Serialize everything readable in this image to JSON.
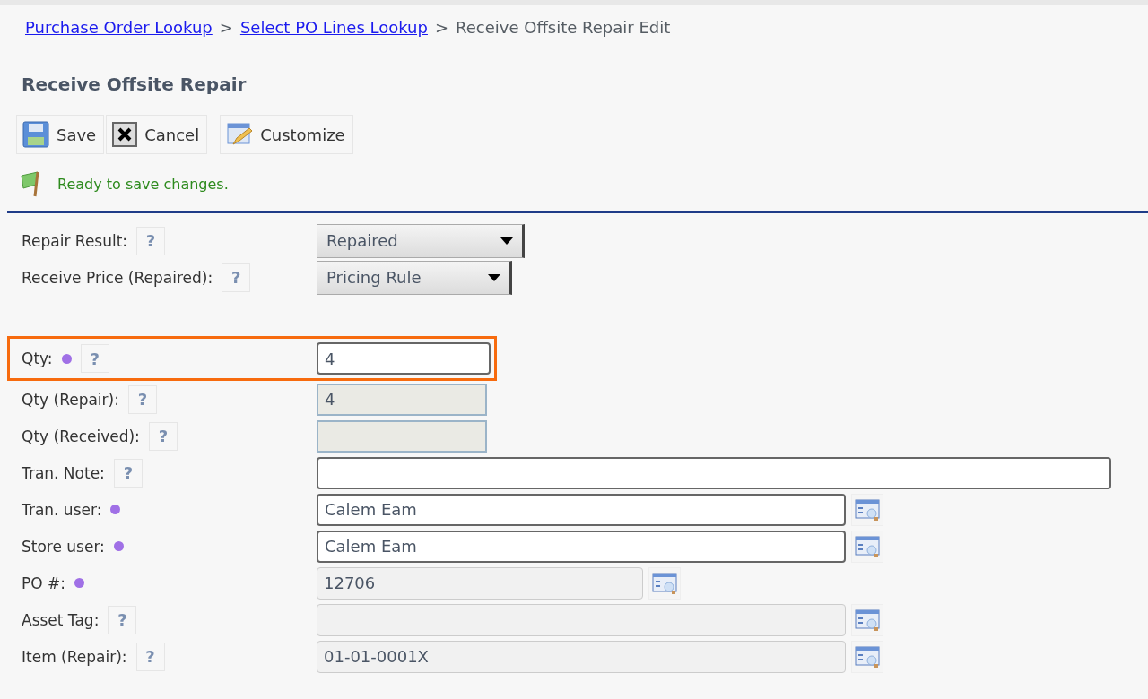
{
  "breadcrumb": {
    "links": [
      "Purchase Order Lookup",
      "Select PO Lines Lookup"
    ],
    "separators": [
      ">",
      ">"
    ],
    "current": "Receive Offsite Repair Edit"
  },
  "title": "Receive Offsite Repair",
  "toolbar": [
    {
      "label": "Save",
      "kind": "save"
    },
    {
      "label": "Cancel",
      "kind": "cancel"
    },
    {
      "label": "Customize",
      "kind": "customize"
    }
  ],
  "status": "Ready to save changes.",
  "fields": [
    {
      "label": "Repair Result:",
      "kind": "select",
      "value": "Repaired",
      "required": false,
      "help": "?",
      "lookup": false,
      "highlighted": false
    },
    {
      "label": "Receive Price (Repaired):",
      "kind": "select",
      "value": "Pricing Rule",
      "required": false,
      "help": "?",
      "lookup": false,
      "highlighted": false
    },
    {
      "label": "Qty:",
      "kind": "text",
      "value": "4",
      "required": true,
      "help": "?",
      "lookup": false,
      "highlighted": true
    },
    {
      "label": "Qty (Repair):",
      "kind": "readonly",
      "value": "4",
      "required": false,
      "help": "?",
      "lookup": false,
      "highlighted": false
    },
    {
      "label": "Qty (Received):",
      "kind": "readonly",
      "required": false,
      "help": "?",
      "lookup": false,
      "highlighted": false
    },
    {
      "label": "Tran. Note:",
      "kind": "text",
      "required": false,
      "help": "?",
      "lookup": false,
      "highlighted": false
    },
    {
      "label": "Tran. user:",
      "kind": "text",
      "value": "Calem Eam",
      "required": true,
      "lookup": true,
      "highlighted": false
    },
    {
      "label": "Store user:",
      "kind": "text",
      "value": "Calem Eam",
      "required": true,
      "lookup": true,
      "highlighted": false
    },
    {
      "label": "PO #:",
      "kind": "disabled",
      "value": "12706",
      "required": true,
      "lookup": true,
      "highlighted": false
    },
    {
      "label": "Asset Tag:",
      "kind": "disabled",
      "required": false,
      "help": "?",
      "lookup": true,
      "highlighted": false
    },
    {
      "label": "Item (Repair):",
      "kind": "disabled",
      "value": "01-01-0001X",
      "required": false,
      "help": "?",
      "lookup": true,
      "highlighted": false
    }
  ]
}
